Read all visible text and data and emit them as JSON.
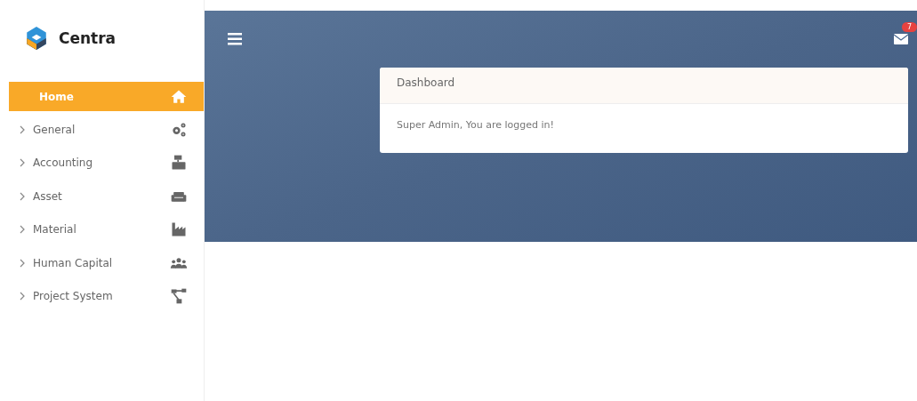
{
  "brand": {
    "name": "Centra"
  },
  "sidebar": {
    "items": [
      {
        "label": "Home",
        "kind": "link",
        "selected": true
      },
      {
        "label": "General",
        "kind": "submenu",
        "selected": false,
        "expanded": false
      },
      {
        "label": "Accounting",
        "kind": "submenu",
        "selected": false,
        "expanded": false
      },
      {
        "label": "Asset",
        "kind": "submenu",
        "selected": false,
        "expanded": false
      },
      {
        "label": "Material",
        "kind": "submenu",
        "selected": false,
        "expanded": false
      },
      {
        "label": "Human Capital",
        "kind": "submenu",
        "selected": false,
        "expanded": false
      },
      {
        "label": "Project System",
        "kind": "submenu",
        "selected": false,
        "expanded": false
      }
    ]
  },
  "header": {
    "mail_badge": "7"
  },
  "card": {
    "title": "Dashboard",
    "message": "Super Admin, You are logged in!"
  }
}
